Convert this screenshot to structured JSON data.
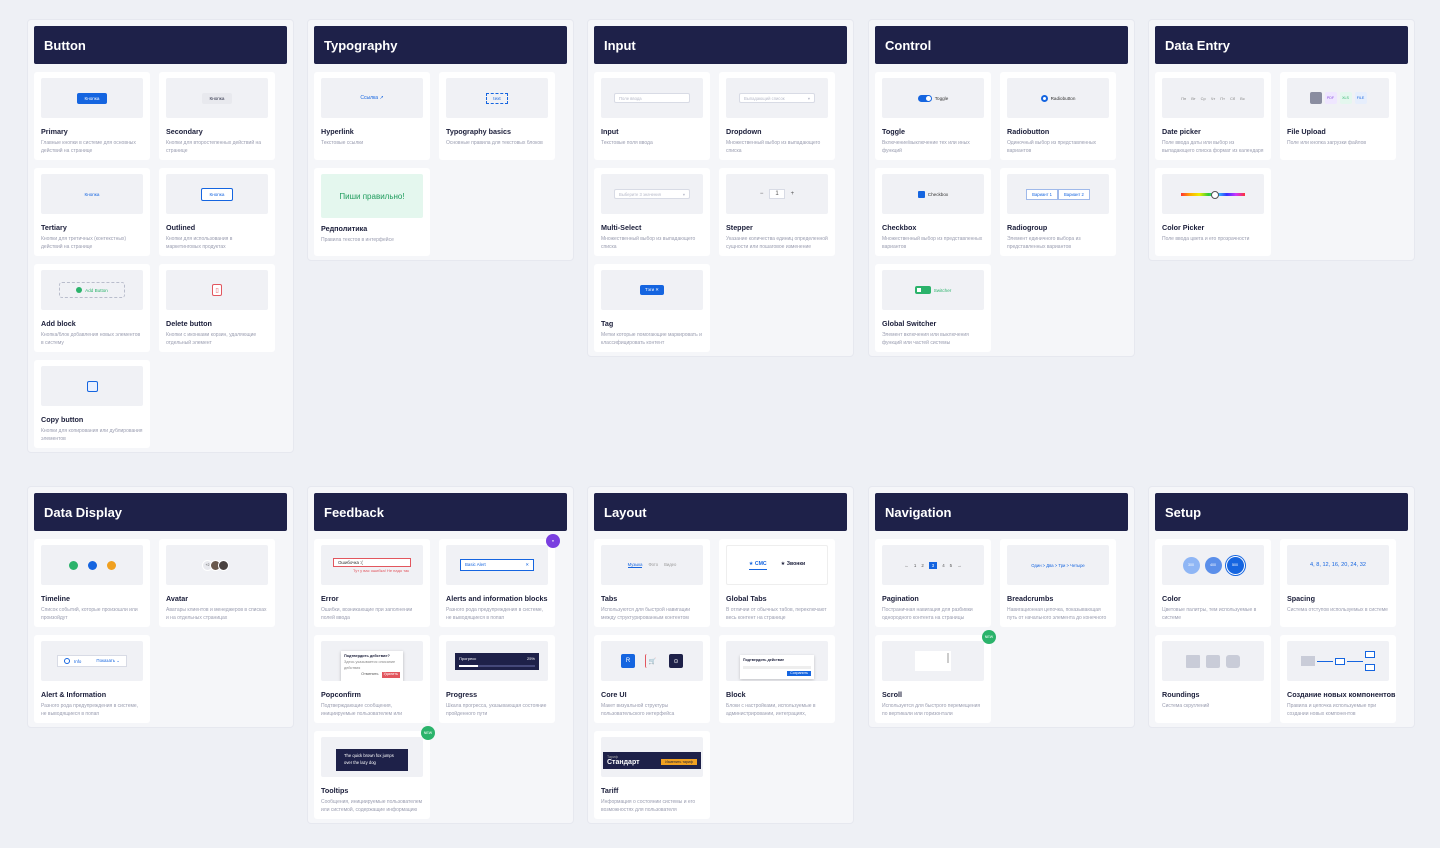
{
  "sections": {
    "button": {
      "title": "Button",
      "cards": [
        {
          "title": "Primary",
          "desc": "Главные кнопки в системе для основных действий на странице",
          "preview": "Кнопка"
        },
        {
          "title": "Secondary",
          "desc": "Кнопки для второстепенных действий на странице",
          "preview": "Кнопка"
        },
        {
          "title": "Tertiary",
          "desc": "Кнопки для третичных (контекстных) действий на странице",
          "preview": "Кнопка"
        },
        {
          "title": "Outlined",
          "desc": "Кнопки для использования в маркетинговых продуктах",
          "preview": "Кнопка"
        },
        {
          "title": "Add block",
          "desc": "Кнопка/блок добавления новых элементов в систему",
          "preview": "Add Button"
        },
        {
          "title": "Delete button",
          "desc": "Кнопки с иконками корзин, удаляющие отдельный элемент"
        },
        {
          "title": "Copy button",
          "desc": "Кнопки для копирования или дублирования элементов"
        }
      ]
    },
    "typography": {
      "title": "Typography",
      "cards": [
        {
          "title": "Hyperlink",
          "desc": "Текстовые ссылки",
          "preview": "Ссылка ↗"
        },
        {
          "title": "Typography basics",
          "desc": "Основные правила для текстовых блоков",
          "preview": "text"
        },
        {
          "title": "Редполитика",
          "desc": "Правила текстов в интерфейсе",
          "preview": "Пиши правильно!"
        }
      ]
    },
    "input": {
      "title": "Input",
      "cards": [
        {
          "title": "Input",
          "desc": "Текстовые поля ввода",
          "preview": "Поле ввода"
        },
        {
          "title": "Dropdown",
          "desc": "Множественный выбор из выпадающего списка",
          "preview": "Выпадающий список"
        },
        {
          "title": "Multi-Select",
          "desc": "Множественный выбор из выпадающего списка",
          "preview": "Выберите 3 значения"
        },
        {
          "title": "Stepper",
          "desc": "Указание количества единиц определенной сущности или пошаговое изменение",
          "preview": "1"
        },
        {
          "title": "Tag",
          "desc": "Метки которые помогающие маркировать и классифицировать контент",
          "preview": "Тэги ✕"
        }
      ]
    },
    "control": {
      "title": "Control",
      "cards": [
        {
          "title": "Toggle",
          "desc": "Включение/выключение тех или иных функций",
          "preview": "Toggle"
        },
        {
          "title": "Radiobutton",
          "desc": "Одиночный выбор из представленных вариантов",
          "preview": "Radiobutton"
        },
        {
          "title": "Checkbox",
          "desc": "Множественный выбор из представленных вариантов",
          "preview": "Checkbox"
        },
        {
          "title": "Radiogroup",
          "desc": "Элемент единичного выбора из представленных вариантов",
          "preview_a": "Вариант 1",
          "preview_b": "Вариант 2"
        },
        {
          "title": "Global Switcher",
          "desc": "Элемент включения или выключения функций или частей системы",
          "preview": "Switcher"
        }
      ]
    },
    "data_entry": {
      "title": "Data Entry",
      "cards": [
        {
          "title": "Date picker",
          "desc": "Поле ввода даты или выбор из выпадающего списка формат из календаря",
          "days": [
            "Пн",
            "Вт",
            "Ср",
            "Чт",
            "Пт",
            "Сб",
            "Вс"
          ]
        },
        {
          "title": "File Upload",
          "desc": "Поле или кнопка загрузки файлов",
          "files": [
            "",
            "PDF",
            "XLS",
            "FILE"
          ]
        },
        {
          "title": "Color Picker",
          "desc": "Поле ввода цвета и его прозрачности"
        }
      ]
    },
    "data_display": {
      "title": "Data Display",
      "cards": [
        {
          "title": "Timeline",
          "desc": "Список событий, которые произошли или произойдут"
        },
        {
          "title": "Avatar",
          "desc": "Аватары клиентов и менеджеров в списках и на отдельных страницах",
          "preview": "+2"
        },
        {
          "title": "Alert & Information",
          "desc": "Разного рода предупреждения в системе, не выводящиеся в попап",
          "preview_a": "Info",
          "preview_b": "Показать ⌄"
        }
      ]
    },
    "feedback": {
      "title": "Feedback",
      "cards": [
        {
          "title": "Error",
          "desc": "Ошибки, возникающие при заполнении полей ввода",
          "preview_a": "Ошибочка :(",
          "preview_b": "Тут у вас ошибка! Не надо так"
        },
        {
          "title": "Alerts and information blocks",
          "desc": "Разного рода предупреждения в системе, не выводящиеся в попап",
          "preview": "Basic Alert"
        },
        {
          "title": "Popconfirm",
          "desc": "Подтверждающие сообщения, инициируемые пользователем или системой",
          "preview_a": "Подтвердить действие?",
          "preview_b": "Здесь указывается описание действия",
          "btn_a": "Отменить",
          "btn_b": "Удалить"
        },
        {
          "title": "Progress",
          "desc": "Шкала прогресса, указывающая состояние пройденного пути",
          "preview_a": "Прогресс",
          "preview_b": "25%",
          "progress": 0.25
        },
        {
          "title": "Tooltips",
          "desc": "Сообщения, инициируемые пользователем или системой, содержащие информацию",
          "preview": "The quick brown fox jumps over the lazy dog",
          "badge": "NEW"
        }
      ]
    },
    "layout": {
      "title": "Layout",
      "cards": [
        {
          "title": "Tabs",
          "desc": "Используются для быстрой навигации между структурированным контентом",
          "tabs": [
            "Музыка",
            "Фото",
            "Видео"
          ]
        },
        {
          "title": "Global Tabs",
          "desc": "В отличии от обычных табов, переключают весь контент на странице",
          "tab_a": "★ СМС",
          "tab_b": "★ Звонки"
        },
        {
          "title": "Core UI",
          "desc": "Макет визуальной структуры пользовательского интерфейса"
        },
        {
          "title": "Block",
          "desc": "Блоки с настройками, используемые в администрировании, интеграциях, триггерах",
          "preview_a": "Подтвердить действие",
          "preview_b": "Сохранить"
        },
        {
          "title": "Tariff",
          "desc": "Информация о состоянии системы и его возможностях для пользователя",
          "preview_a": "Тариф",
          "preview_b": "Стандарт",
          "preview_c": "Изменить тариф"
        }
      ]
    },
    "navigation": {
      "title": "Navigation",
      "cards": [
        {
          "title": "Pagination",
          "desc": "Постраничная навигация для разбивки однородного контента на страницы",
          "pages": [
            "←",
            "1",
            "2",
            "3",
            "4",
            "5",
            "→"
          ]
        },
        {
          "title": "Breadcrumbs",
          "desc": "Навигационная цепочка, показывающая путь от начального элемента до конечного",
          "preview": "Один  >  Два  >  Три  >  Четыре"
        },
        {
          "title": "Scroll",
          "desc": "Используется для быстрого перемещения по вертикали или горизонтали",
          "badge": "NEW"
        }
      ]
    },
    "setup": {
      "title": "Setup",
      "cards": [
        {
          "title": "Color",
          "desc": "Цветовые палитры, тем используемые в системе",
          "swatches": [
            "300",
            "400",
            "500"
          ]
        },
        {
          "title": "Spacing",
          "desc": "Система отступов используемых в системе",
          "preview": "4, 8, 12, 16, 20, 24, 32"
        },
        {
          "title": "Roundings",
          "desc": "Система скруглений"
        },
        {
          "title": "Создание новых компонентов",
          "desc": "Правила и цепочка используемые при создании новых компонентов"
        }
      ]
    }
  },
  "colors": {
    "header": "#1e2149",
    "accent": "#1565e0",
    "success": "#2bb36b",
    "danger": "#e2565e"
  }
}
